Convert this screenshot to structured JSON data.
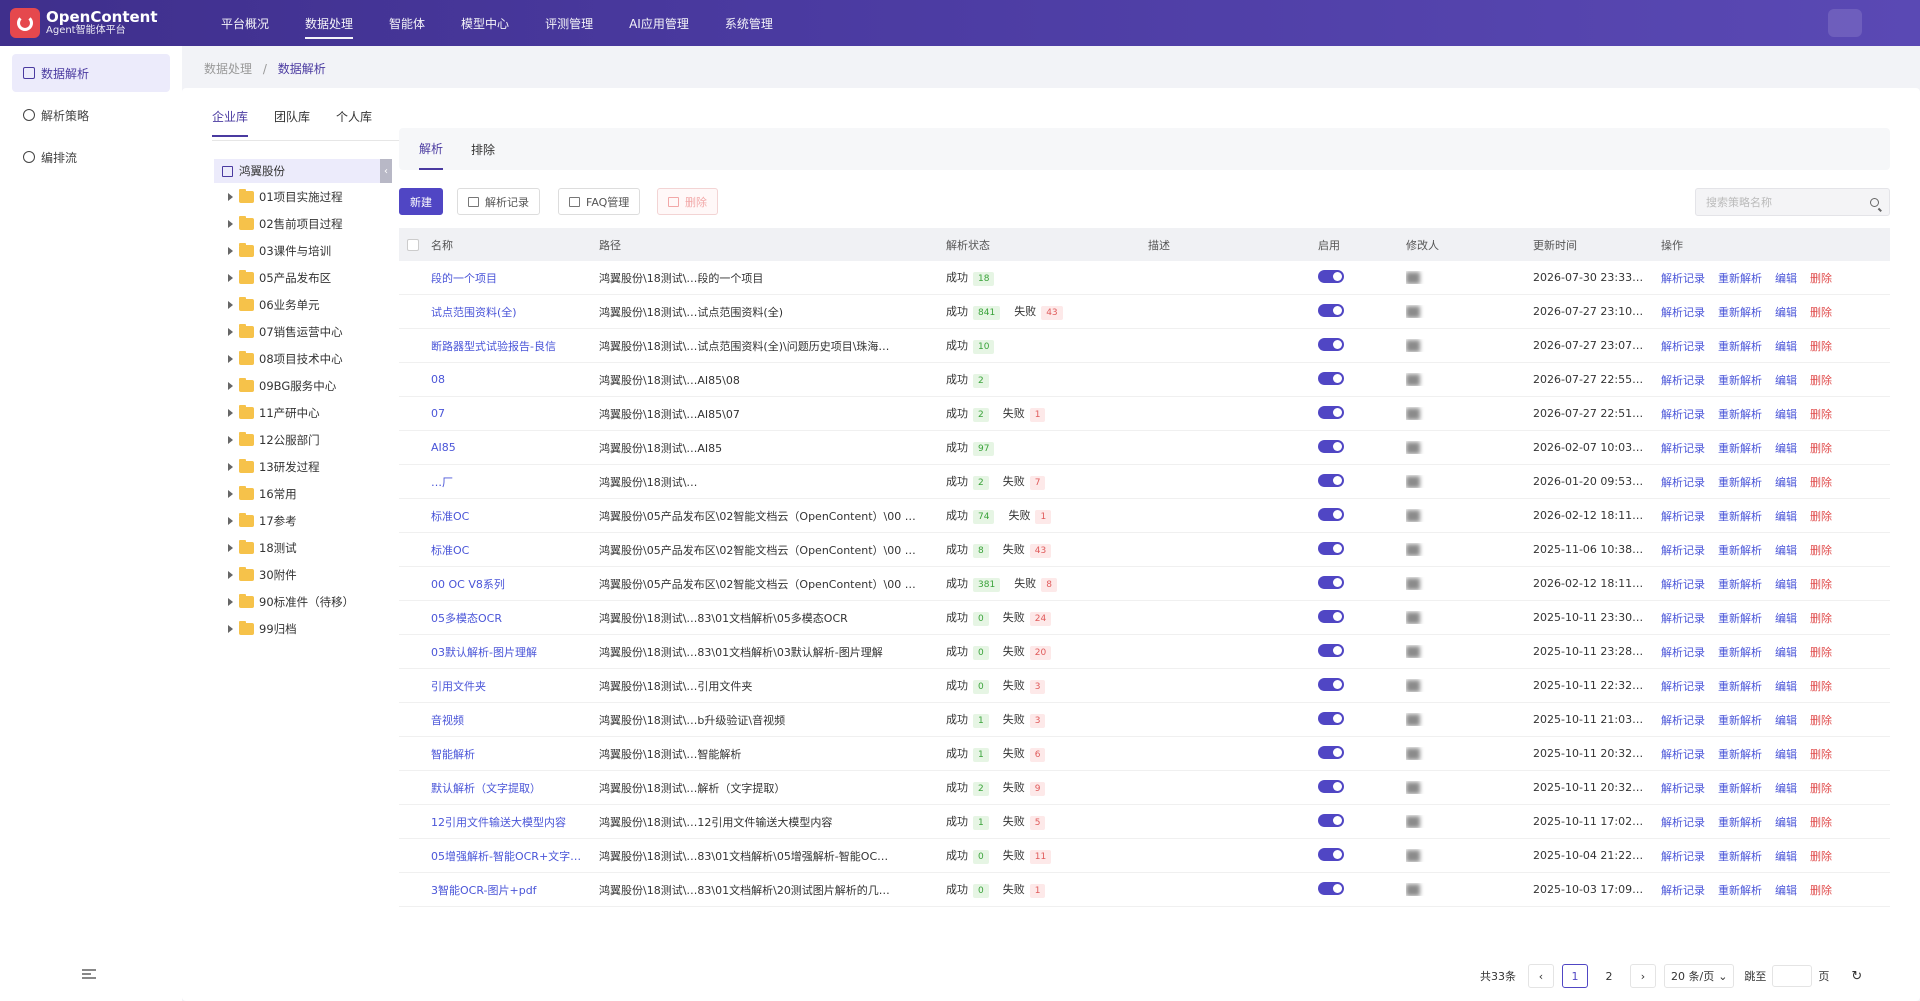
{
  "app": {
    "title": "OpenContent",
    "subtitle": "Agent智能体平台"
  },
  "nav": [
    "平台概况",
    "数据处理",
    "智能体",
    "模型中心",
    "评测管理",
    "AI应用管理",
    "系统管理"
  ],
  "sidebar": [
    "数据解析",
    "解析策略",
    "编排流"
  ],
  "breadcrumb": {
    "parent": "数据处理",
    "current": "数据解析"
  },
  "lib_tabs": [
    "企业库",
    "团队库",
    "个人库"
  ],
  "tree": {
    "root": "鸿翼股份",
    "nodes": [
      "01项目实施过程",
      "02售前项目过程",
      "03课件与培训",
      "05产品发布区",
      "06业务单元",
      "07销售运营中心",
      "08项目技术中心",
      "09BG服务中心",
      "11产研中心",
      "12公服部门",
      "13研发过程",
      "16常用",
      "17参考",
      "18测试",
      "30附件",
      "90标准件（待移）",
      "99归档"
    ]
  },
  "sub_tabs": [
    "解析",
    "排除"
  ],
  "toolbar": {
    "new": "新建",
    "log": "解析记录",
    "faq": "FAQ管理",
    "delete": "删除",
    "search_placeholder": "搜索策略名称"
  },
  "table": {
    "headers": [
      "名称",
      "路径",
      "解析状态",
      "描述",
      "启用",
      "修改人",
      "更新时间",
      "操作"
    ],
    "ops": [
      "解析记录",
      "重新解析",
      "编辑",
      "删除"
    ],
    "success_label": "成功",
    "fail_label": "失败",
    "rows": [
      {
        "name": "段的一个项目",
        "path": "鸿翼股份\\18测试\\…段的一个项目",
        "ok": "18",
        "fail": "",
        "time": "2026-07-30 23:33…"
      },
      {
        "name": "试点范围资料(全)",
        "path": "鸿翼股份\\18测试\\…试点范围资料(全)",
        "ok": "841",
        "fail": "43",
        "time": "2026-07-27 23:10…"
      },
      {
        "name": "断路器型式试验报告-良信",
        "path": "鸿翼股份\\18测试\\…试点范围资料(全)\\问题历史项目\\珠海…",
        "ok": "10",
        "fail": "",
        "time": "2026-07-27 23:07…"
      },
      {
        "name": "08",
        "path": "鸿翼股份\\18测试\\…AI85\\08",
        "ok": "2",
        "fail": "",
        "time": "2026-07-27 22:55…"
      },
      {
        "name": "07",
        "path": "鸿翼股份\\18测试\\…AI85\\07",
        "ok": "2",
        "fail": "1",
        "time": "2026-07-27 22:51…"
      },
      {
        "name": "AI85",
        "path": "鸿翼股份\\18测试\\…AI85",
        "ok": "97",
        "fail": "",
        "time": "2026-02-07 10:03…"
      },
      {
        "name": "…厂",
        "path": "鸿翼股份\\18测试\\…",
        "ok": "2",
        "fail": "7",
        "time": "2026-01-20 09:53…"
      },
      {
        "name": "标准OC",
        "path": "鸿翼股份\\05产品发布区\\02智能文档云（OpenContent）\\00 …",
        "ok": "74",
        "fail": "1",
        "time": "2026-02-12 18:11…"
      },
      {
        "name": "标准OC",
        "path": "鸿翼股份\\05产品发布区\\02智能文档云（OpenContent）\\00 …",
        "ok": "8",
        "fail": "43",
        "time": "2025-11-06 10:38…"
      },
      {
        "name": "00 OC V8系列",
        "path": "鸿翼股份\\05产品发布区\\02智能文档云（OpenContent）\\00 …",
        "ok": "381",
        "fail": "8",
        "time": "2026-02-12 18:11…"
      },
      {
        "name": "05多模态OCR",
        "path": "鸿翼股份\\18测试\\…83\\01文档解析\\05多模态OCR",
        "ok": "0",
        "fail": "24",
        "time": "2025-10-11 23:30…"
      },
      {
        "name": "03默认解析-图片理解",
        "path": "鸿翼股份\\18测试\\…83\\01文档解析\\03默认解析-图片理解",
        "ok": "0",
        "fail": "20",
        "time": "2025-10-11 23:28…"
      },
      {
        "name": "引用文件夹",
        "path": "鸿翼股份\\18测试\\…引用文件夹",
        "ok": "0",
        "fail": "3",
        "time": "2025-10-11 22:32…"
      },
      {
        "name": "音视频",
        "path": "鸿翼股份\\18测试\\…b升级验证\\音视频",
        "ok": "1",
        "fail": "3",
        "time": "2025-10-11 21:03…"
      },
      {
        "name": "智能解析",
        "path": "鸿翼股份\\18测试\\…智能解析",
        "ok": "1",
        "fail": "6",
        "time": "2025-10-11 20:32…"
      },
      {
        "name": "默认解析（文字提取）",
        "path": "鸿翼股份\\18测试\\…解析（文字提取）",
        "ok": "2",
        "fail": "9",
        "time": "2025-10-11 20:32…"
      },
      {
        "name": "12引用文件输送大模型内容",
        "path": "鸿翼股份\\18测试\\…12引用文件输送大模型内容",
        "ok": "1",
        "fail": "5",
        "time": "2025-10-11 17:02…"
      },
      {
        "name": "05增强解析-智能OCR+文字…",
        "path": "鸿翼股份\\18测试\\…83\\01文档解析\\05增强解析-智能OC…",
        "ok": "0",
        "fail": "11",
        "time": "2025-10-04 21:22…"
      },
      {
        "name": "3智能OCR-图片+pdf",
        "path": "鸿翼股份\\18测试\\…83\\01文档解析\\20测试图片解析的几…",
        "ok": "0",
        "fail": "1",
        "time": "2025-10-03 17:09…"
      }
    ]
  },
  "pager": {
    "total": "共33条",
    "pages": [
      "1",
      "2"
    ],
    "size": "20 条/页",
    "jump": "跳至",
    "page_unit": "页"
  },
  "colors": {
    "primary": "#5046c4",
    "link": "#4a55d8",
    "danger": "#e04b4b",
    "topbar": "#4a3aa0"
  }
}
